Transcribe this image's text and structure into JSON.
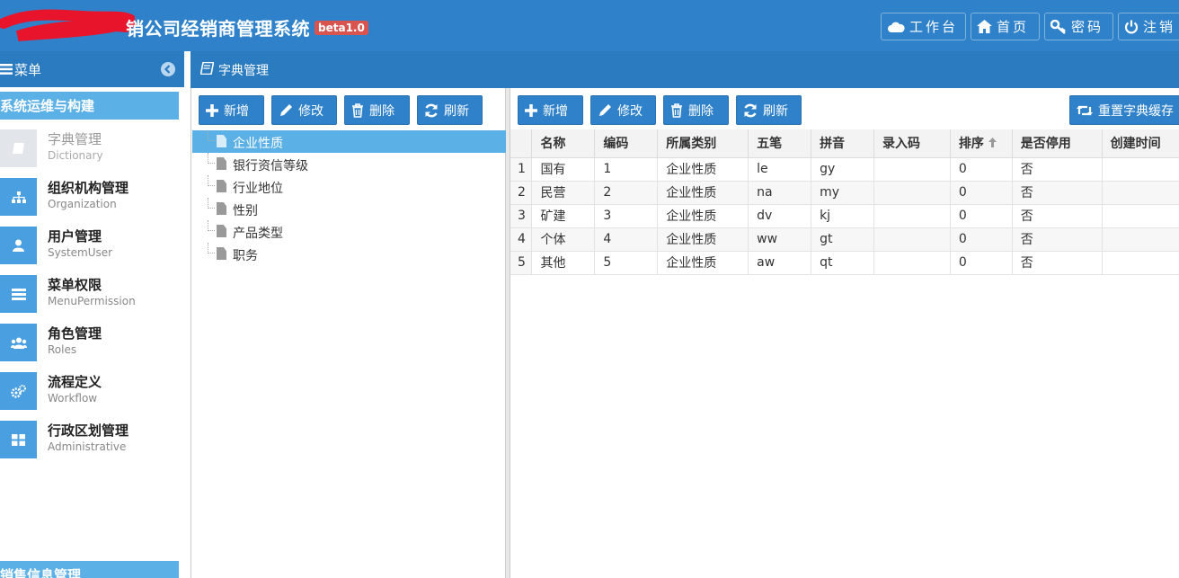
{
  "app": {
    "title": "销公司经销商管理系统",
    "version_badge": "beta1.0"
  },
  "header_buttons": [
    {
      "label": "工作台",
      "icon": "cloud-icon"
    },
    {
      "label": "首页",
      "icon": "home-icon"
    },
    {
      "label": "密码",
      "icon": "key-icon"
    },
    {
      "label": "注销",
      "icon": "power-icon"
    }
  ],
  "sidebar": {
    "menu_label": "菜单",
    "group1": "系统运维与构建",
    "items": [
      {
        "title": "字典管理",
        "sub": "Dictionary",
        "icon": "book-icon",
        "active": true
      },
      {
        "title": "组织机构管理",
        "sub": "Organization",
        "icon": "sitemap-icon"
      },
      {
        "title": "用户管理",
        "sub": "SystemUser",
        "icon": "user-icon"
      },
      {
        "title": "菜单权限",
        "sub": "MenuPermission",
        "icon": "menu-list-icon"
      },
      {
        "title": "角色管理",
        "sub": "Roles",
        "icon": "group-icon"
      },
      {
        "title": "流程定义",
        "sub": "Workflow",
        "icon": "cogs-icon"
      },
      {
        "title": "行政区划管理",
        "sub": "Administrative",
        "icon": "grid-icon"
      }
    ],
    "group2": "销售信息管理"
  },
  "page": {
    "title": "字典管理"
  },
  "left_toolbar": {
    "add": "新增",
    "edit": "修改",
    "delete": "删除",
    "refresh": "刷新"
  },
  "right_toolbar": {
    "add": "新增",
    "edit": "修改",
    "delete": "删除",
    "refresh": "刷新",
    "reset_cache": "重置字典缓存"
  },
  "tree": [
    {
      "label": "企业性质",
      "selected": true
    },
    {
      "label": "银行资信等级"
    },
    {
      "label": "行业地位"
    },
    {
      "label": "性别"
    },
    {
      "label": "产品类型"
    },
    {
      "label": "职务"
    }
  ],
  "grid": {
    "columns": [
      "名称",
      "编码",
      "所属类别",
      "五笔",
      "拼音",
      "录入码",
      "排序",
      "是否停用",
      "创建时间"
    ],
    "sort_column": "排序",
    "sort_direction": "asc",
    "rows": [
      [
        "1",
        "国有",
        "1",
        "企业性质",
        "le",
        "gy",
        "",
        "0",
        "否",
        ""
      ],
      [
        "2",
        "民营",
        "2",
        "企业性质",
        "na",
        "my",
        "",
        "0",
        "否",
        ""
      ],
      [
        "3",
        "矿建",
        "3",
        "企业性质",
        "dv",
        "kj",
        "",
        "0",
        "否",
        ""
      ],
      [
        "4",
        "个体",
        "4",
        "企业性质",
        "ww",
        "gt",
        "",
        "0",
        "否",
        ""
      ],
      [
        "5",
        "其他",
        "5",
        "企业性质",
        "aw",
        "qt",
        "",
        "0",
        "否",
        ""
      ]
    ]
  },
  "colors": {
    "header": "#2f82c9",
    "sidebar_group": "#5bb0e6",
    "selection": "#5bb0e6",
    "beta_badge": "#d9534f"
  }
}
